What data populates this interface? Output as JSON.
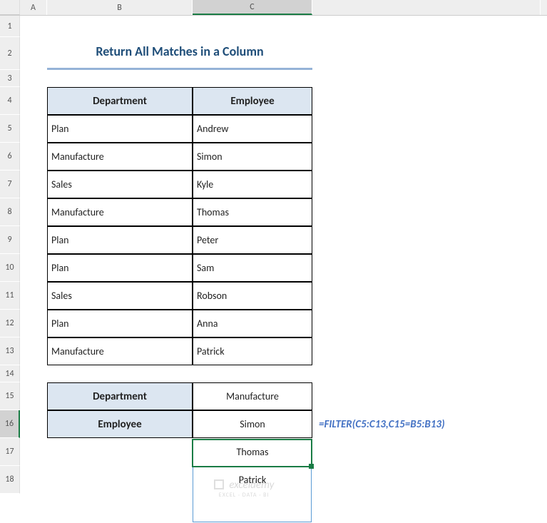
{
  "columns": [
    "A",
    "B",
    "C"
  ],
  "row_count": 18,
  "title": "Return All Matches in a Column",
  "table1": {
    "headers": {
      "dept": "Department",
      "emp": "Employee"
    },
    "rows": [
      {
        "dept": "Plan",
        "emp": "Andrew"
      },
      {
        "dept": "Manufacture",
        "emp": "Simon"
      },
      {
        "dept": "Sales",
        "emp": "Kyle"
      },
      {
        "dept": "Manufacture",
        "emp": "Thomas"
      },
      {
        "dept": "Plan",
        "emp": "Peter"
      },
      {
        "dept": "Plan",
        "emp": "Sam"
      },
      {
        "dept": "Sales",
        "emp": "Robson"
      },
      {
        "dept": "Plan",
        "emp": "Anna"
      },
      {
        "dept": "Manufacture",
        "emp": "Patrick"
      }
    ]
  },
  "lookup": {
    "dept_label": "Department",
    "dept_value": "Manufacture",
    "emp_label": "Employee",
    "emp_results": [
      "Simon",
      "Thomas",
      "Patrick"
    ]
  },
  "formula": "=FILTER(C5:C13,C15=B5:B13)",
  "watermark": {
    "brand": "exceldemy",
    "tag": "EXCEL · DATA · BI"
  },
  "selected_cell": "C16"
}
